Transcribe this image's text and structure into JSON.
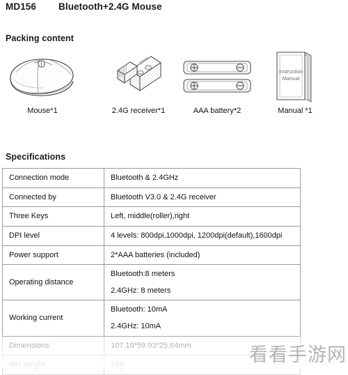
{
  "header": {
    "model": "MD156",
    "title": "Bluetooth+2.4G Mouse"
  },
  "sections": {
    "packing_heading": "Packing content",
    "spec_heading": "Specifications"
  },
  "packing_items": [
    {
      "icon": "mouse-icon",
      "label": "Mouse*1"
    },
    {
      "icon": "usb-receiver-icon",
      "label": "2.4G receiver*1"
    },
    {
      "icon": "aaa-battery-icon",
      "label": "AAA battery*2"
    },
    {
      "icon": "manual-book-icon",
      "label": "Manual *1"
    }
  ],
  "manual_cover": {
    "line1": "Instruction",
    "line2": "Manual"
  },
  "battery_symbols": {
    "positive": "⊕",
    "negative": "⊖"
  },
  "spec_rows": [
    {
      "key": "Connection mode",
      "values": [
        "Bluetooth & 2.4GHz"
      ]
    },
    {
      "key": "Connected by",
      "values": [
        "Bluetooth V3.0 & 2.4G receiver"
      ]
    },
    {
      "key": "Three Keys",
      "values": [
        "Left, middle(roller),right"
      ]
    },
    {
      "key": "DPI level",
      "values": [
        "4 levels: 800dpi,1000dpi, 1200dpi(default),1600dpi"
      ]
    },
    {
      "key": "Power support",
      "values": [
        "2*AAA batteries (included)"
      ]
    },
    {
      "key": "Operating distance",
      "values": [
        "Bluetooth:8 meters",
        "2.4GHz: 8 meters"
      ]
    },
    {
      "key": "Working current",
      "values": [
        "Bluetooth: 10mA",
        "2.4GHz: 10mA"
      ]
    },
    {
      "key": "Dimensions",
      "values": [
        "107.19*59.93*25.64mm"
      ]
    },
    {
      "key": "Net weight",
      "values": [
        "54g"
      ]
    }
  ],
  "watermark": {
    "text": "看看手游网"
  },
  "colors": {
    "text": "#111111",
    "table_border": "#9a9a9a",
    "faded_text": "#8e8e8e",
    "watermark": "#b4b4b4"
  }
}
